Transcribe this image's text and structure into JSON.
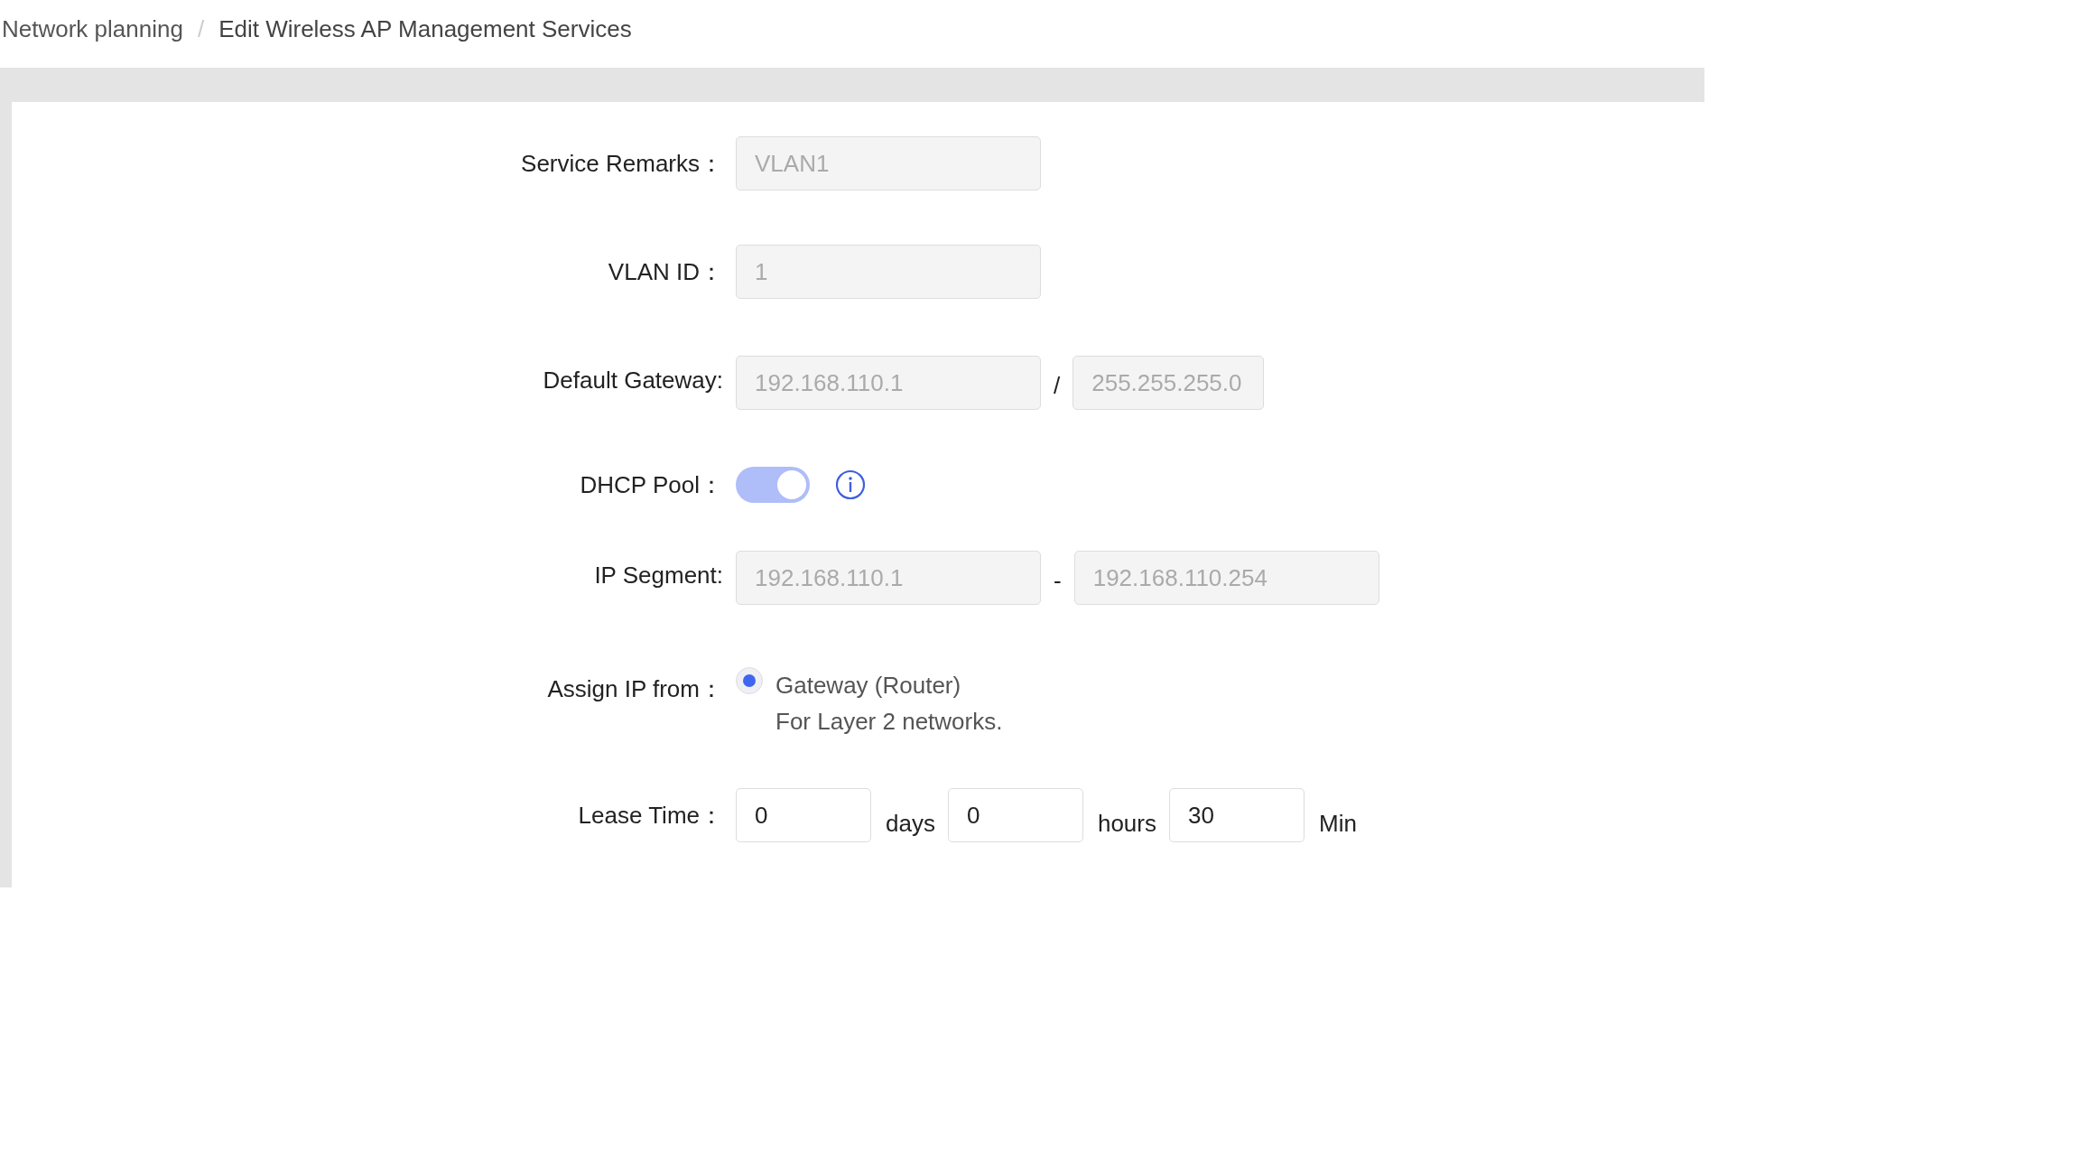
{
  "breadcrumb": {
    "separator": "/",
    "items": [
      {
        "label": "Network planning",
        "current": false
      },
      {
        "label": "Edit Wireless AP Management Services",
        "current": true
      }
    ]
  },
  "form": {
    "rows": [
      {
        "kind": "text",
        "label": "Service Remarks：",
        "fields": [
          {
            "value": "VLAN1",
            "disabled": true
          }
        ]
      },
      {
        "kind": "text",
        "label": "VLAN ID：",
        "fields": [
          {
            "value": "1",
            "disabled": true
          }
        ]
      },
      {
        "kind": "gateway",
        "label": "Default Gateway:",
        "separator": "/",
        "fields": [
          {
            "value": "192.168.110.1",
            "disabled": true
          },
          {
            "value": "255.255.255.0",
            "disabled": true
          }
        ]
      },
      {
        "kind": "toggle",
        "label": "DHCP Pool：",
        "on": true,
        "disabled": true
      },
      {
        "kind": "range",
        "label": "IP Segment:",
        "separator": "-",
        "fields": [
          {
            "value": "192.168.110.1",
            "disabled": true
          },
          {
            "value": "192.168.110.254",
            "disabled": true
          }
        ]
      },
      {
        "kind": "radio",
        "label": "Assign IP from：",
        "options": [
          {
            "label": "Gateway (Router)",
            "description": "For Layer 2 networks.",
            "selected": true
          }
        ]
      },
      {
        "kind": "lease",
        "label": "Lease Time：",
        "fields": [
          {
            "value": "0",
            "unit": "days",
            "disabled": false
          },
          {
            "value": "0",
            "unit": "hours",
            "disabled": false
          },
          {
            "value": "30",
            "unit": "Min",
            "disabled": false
          }
        ]
      }
    ]
  }
}
